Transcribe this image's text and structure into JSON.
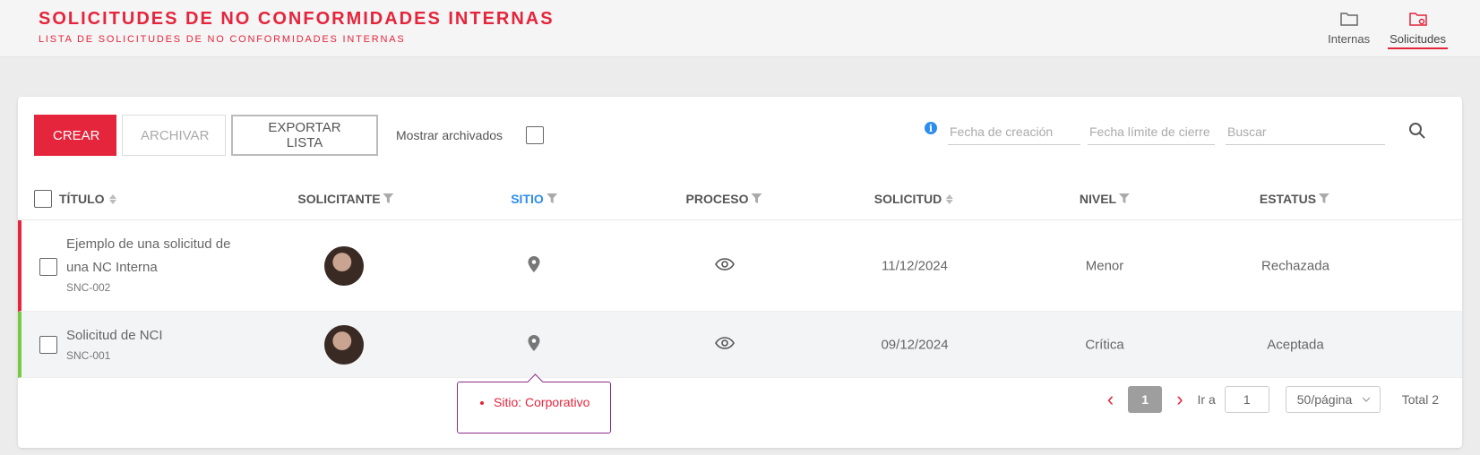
{
  "header": {
    "title": "SOLICITUDES DE NO CONFORMIDADES INTERNAS",
    "subtitle": "LISTA DE SOLICITUDES DE NO CONFORMIDADES INTERNAS",
    "nav": [
      {
        "label": "Internas",
        "icon": "folder-icon",
        "active": false
      },
      {
        "label": "Solicitudes",
        "icon": "folder-settings-icon",
        "active": true
      }
    ]
  },
  "colors": {
    "accent": "#e4253c",
    "active_header": "#2d8cf0",
    "row_rejected": "#e4253c",
    "row_accepted": "#7ac943"
  },
  "toolbar": {
    "create_label": "CREAR",
    "archive_label": "ARCHIVAR",
    "export_label": "EXPORTAR LISTA",
    "show_archived_label": "Mostrar archivados"
  },
  "filters": {
    "created_placeholder": "Fecha de creación",
    "deadline_placeholder": "Fecha límite de cierre",
    "search_placeholder": "Buscar"
  },
  "table": {
    "columns": {
      "title": "TÍTULO",
      "requester": "SOLICITANTE",
      "site": "SITIO",
      "process": "PROCESO",
      "request": "SOLICITUD",
      "level": "NIVEL",
      "status": "ESTATUS"
    },
    "rows": [
      {
        "title": "Ejemplo de una solicitud de una NC Interna",
        "code": "SNC-002",
        "date": "11/12/2024",
        "level": "Menor",
        "status": "Rechazada"
      },
      {
        "title": "Solicitud de NCI",
        "code": "SNC-001",
        "date": "09/12/2024",
        "level": "Crítica",
        "status": "Aceptada"
      }
    ]
  },
  "tooltip": {
    "item": "Sitio: Corporativo"
  },
  "pagination": {
    "current_page": "1",
    "goto_label": "Ir a",
    "goto_value": "1",
    "page_size": "50/página",
    "total": "Total 2"
  }
}
